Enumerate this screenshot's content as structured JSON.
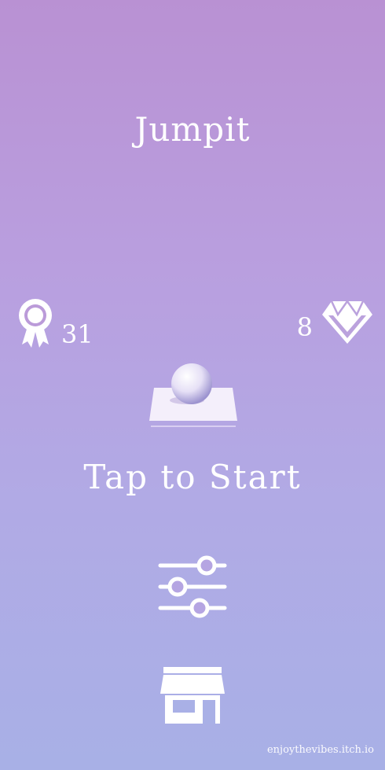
{
  "game": {
    "title": "Jumpit",
    "start_prompt": "Tap to Start"
  },
  "stats": {
    "best_score": "31",
    "gems": "8",
    "best_icon": "ribbon-award-icon",
    "gem_icon": "diamond-icon"
  },
  "menu": {
    "settings_icon": "sliders-icon",
    "shop_icon": "storefront-icon"
  },
  "footer": {
    "credit": "enjoythevibes.itch.io"
  },
  "colors": {
    "background_top": "#b991d3",
    "background_bottom": "#a8b0e6",
    "foreground": "#ffffff"
  }
}
